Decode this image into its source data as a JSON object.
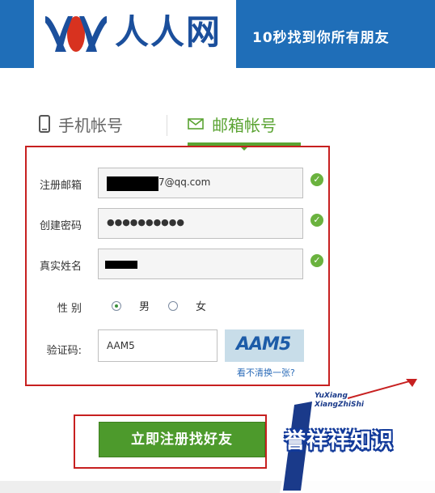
{
  "header": {
    "brand": "人人网",
    "slogan": "10秒找到你所有朋友"
  },
  "tabs": [
    {
      "label": "手机帐号",
      "icon": "phone-icon",
      "active": false
    },
    {
      "label": "邮箱帐号",
      "icon": "envelope-icon",
      "active": true
    }
  ],
  "form": {
    "email": {
      "label": "注册邮箱",
      "value": "7@qq.com"
    },
    "password": {
      "label": "创建密码",
      "value": "●●●●●●●●●●"
    },
    "name": {
      "label": "真实姓名",
      "value": ""
    },
    "gender": {
      "label": "性 别",
      "options": [
        "男",
        "女"
      ],
      "selected": "男"
    },
    "captcha": {
      "label": "验证码:",
      "value": "AAM5",
      "image_text": "AAM5",
      "refresh_link": "看不清换一张?"
    }
  },
  "submit": {
    "label": "立即注册找好友"
  },
  "watermark": {
    "line1": "YuXiang",
    "line2": "XiangZhiShi",
    "big": "誉祥祥知识"
  },
  "colors": {
    "brand_blue": "#1f6eb8",
    "accent_green": "#5aa332",
    "valid_check": "#6ab23e",
    "highlight_red": "#c72020",
    "button_green": "#4d9a2c"
  }
}
